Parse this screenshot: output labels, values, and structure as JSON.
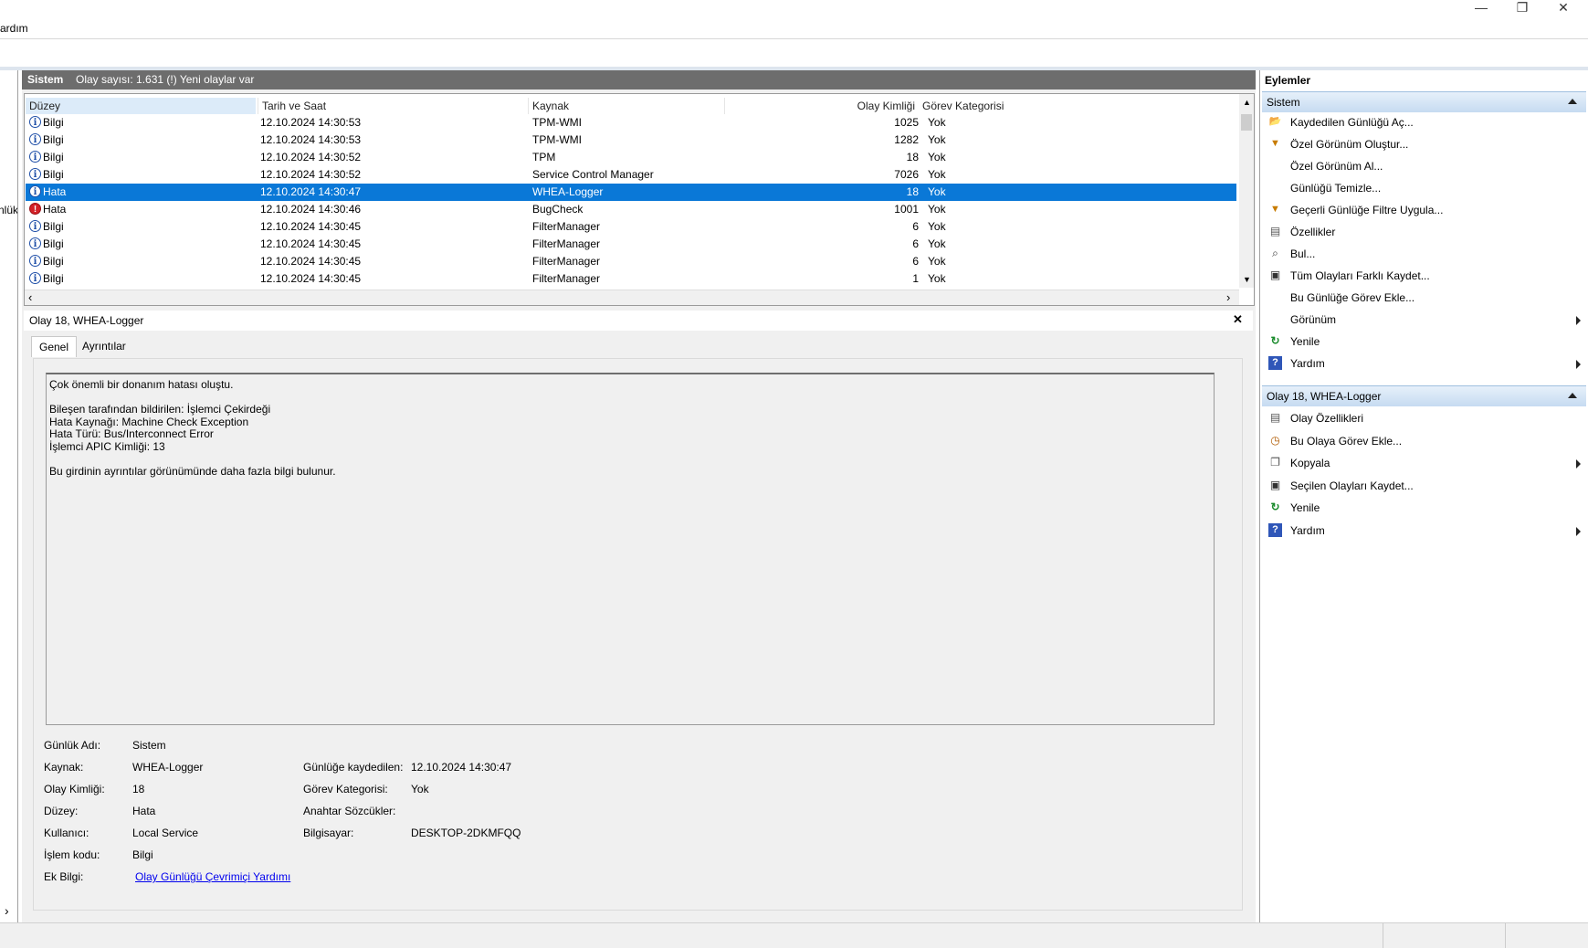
{
  "window": {
    "minimize": "—",
    "restore": "❐",
    "close": "✕"
  },
  "menu": {
    "help_partial": "ardım"
  },
  "leftnav": {
    "partial_label": "nlük",
    "scroll_arrow": "›"
  },
  "log_header": {
    "title": "Sistem",
    "count_text": "Olay sayısı: 1.631 (!) Yeni olaylar var"
  },
  "columns": {
    "level": "Düzey",
    "datetime": "Tarih ve Saat",
    "source": "Kaynak",
    "event_id": "Olay Kimliği",
    "task_category": "Görev Kategorisi"
  },
  "events": [
    {
      "level": "Bilgi",
      "icon": "info-icon",
      "datetime": "12.10.2024 14:30:53",
      "source": "TPM-WMI",
      "id": "1025",
      "category": "Yok"
    },
    {
      "level": "Bilgi",
      "icon": "info-icon",
      "datetime": "12.10.2024 14:30:53",
      "source": "TPM-WMI",
      "id": "1282",
      "category": "Yok"
    },
    {
      "level": "Bilgi",
      "icon": "info-icon",
      "datetime": "12.10.2024 14:30:52",
      "source": "TPM",
      "id": "18",
      "category": "Yok"
    },
    {
      "level": "Bilgi",
      "icon": "info-icon",
      "datetime": "12.10.2024 14:30:52",
      "source": "Service Control Manager",
      "id": "7026",
      "category": "Yok"
    },
    {
      "level": "Hata",
      "icon": "info-icon",
      "datetime": "12.10.2024 14:30:47",
      "source": "WHEA-Logger",
      "id": "18",
      "category": "Yok",
      "selected": true
    },
    {
      "level": "Hata",
      "icon": "error-icon",
      "datetime": "12.10.2024 14:30:46",
      "source": "BugCheck",
      "id": "1001",
      "category": "Yok"
    },
    {
      "level": "Bilgi",
      "icon": "info-icon",
      "datetime": "12.10.2024 14:30:45",
      "source": "FilterManager",
      "id": "6",
      "category": "Yok"
    },
    {
      "level": "Bilgi",
      "icon": "info-icon",
      "datetime": "12.10.2024 14:30:45",
      "source": "FilterManager",
      "id": "6",
      "category": "Yok"
    },
    {
      "level": "Bilgi",
      "icon": "info-icon",
      "datetime": "12.10.2024 14:30:45",
      "source": "FilterManager",
      "id": "6",
      "category": "Yok"
    },
    {
      "level": "Bilgi",
      "icon": "info-icon",
      "datetime": "12.10.2024 14:30:45",
      "source": "FilterManager",
      "id": "1",
      "category": "Yok"
    }
  ],
  "detail": {
    "title": "Olay 18, WHEA-Logger",
    "close": "✕",
    "tabs": [
      "Genel",
      "Ayrıntılar"
    ],
    "message_lines": [
      "Çok önemli bir donanım hatası oluştu.",
      "",
      "Bileşen tarafından bildirilen: İşlemci Çekirdeği",
      "Hata Kaynağı: Machine Check Exception",
      "Hata Türü: Bus/Interconnect Error",
      "İşlemci APIC Kimliği: 13",
      "",
      "Bu girdinin ayrıntılar görünümünde daha fazla bilgi bulunur."
    ],
    "props": {
      "log_name_label": "Günlük Adı:",
      "log_name": "Sistem",
      "source_label": "Kaynak:",
      "source": "WHEA-Logger",
      "logged_label": "Günlüğe kaydedilen:",
      "logged": "12.10.2024 14:30:47",
      "event_id_label": "Olay Kimliği:",
      "event_id": "18",
      "task_label": "Görev Kategorisi:",
      "task": "Yok",
      "level_label": "Düzey:",
      "level": "Hata",
      "keywords_label": "Anahtar Sözcükler:",
      "keywords": "",
      "user_label": "Kullanıcı:",
      "user": "Local Service",
      "computer_label": "Bilgisayar:",
      "computer": "DESKTOP-2DKMFQQ",
      "opcode_label": "İşlem kodu:",
      "opcode": "Bilgi",
      "more_info_label": "Ek Bilgi:",
      "more_info_link": "Olay Günlüğü Çevrimiçi Yardımı"
    }
  },
  "actions": {
    "header": "Eylemler",
    "group1": {
      "title": "Sistem",
      "items": [
        {
          "label": "Kaydedilen Günlüğü Aç...",
          "icon": "open-folder-icon"
        },
        {
          "label": "Özel Görünüm Oluştur...",
          "icon": "filter-icon"
        },
        {
          "label": "Özel Görünüm Al...",
          "icon": ""
        },
        {
          "label": "Günlüğü Temizle...",
          "icon": ""
        },
        {
          "label": "Geçerli Günlüğe Filtre Uygula...",
          "icon": "filter-icon"
        },
        {
          "label": "Özellikler",
          "icon": "properties-icon"
        },
        {
          "label": "Bul...",
          "icon": "binoculars-icon"
        },
        {
          "label": "Tüm Olayları Farklı Kaydet...",
          "icon": "save-icon"
        },
        {
          "label": "Bu Günlüğe Görev Ekle...",
          "icon": ""
        },
        {
          "label": "Görünüm",
          "icon": "",
          "submenu": true
        },
        {
          "label": "Yenile",
          "icon": "refresh-icon"
        },
        {
          "label": "Yardım",
          "icon": "help-icon",
          "submenu": true
        }
      ]
    },
    "group2": {
      "title": "Olay 18, WHEA-Logger",
      "items": [
        {
          "label": "Olay Özellikleri",
          "icon": "properties-icon"
        },
        {
          "label": "Bu Olaya Görev Ekle...",
          "icon": "task-icon"
        },
        {
          "label": "Kopyala",
          "icon": "copy-icon",
          "submenu": true
        },
        {
          "label": "Seçilen Olayları Kaydet...",
          "icon": "save-icon"
        },
        {
          "label": "Yenile",
          "icon": "refresh-icon"
        },
        {
          "label": "Yardım",
          "icon": "help-icon",
          "submenu": true
        }
      ]
    }
  },
  "colors": {
    "selection": "#0a78d7",
    "header_bar": "#6d6d6d",
    "group_bg": "#c6dbf1",
    "link": "#0000ee"
  }
}
